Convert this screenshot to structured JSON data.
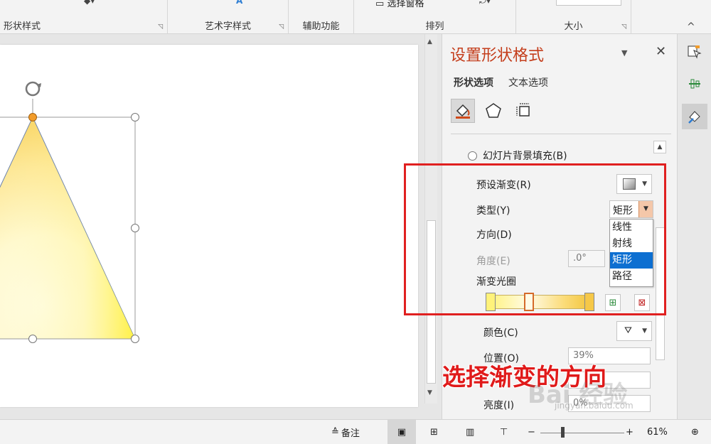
{
  "ribbon": {
    "groups": [
      {
        "label": "形状样式",
        "launcher": "◹"
      },
      {
        "label": "艺术字样式",
        "launcher": "◹"
      },
      {
        "label": "辅助功能"
      },
      {
        "label": "排列"
      },
      {
        "label": "大小",
        "launcher": "◹"
      }
    ],
    "selection_pane_label": "选择窗格",
    "collapse_icon": "^"
  },
  "pane": {
    "title": "设置形状格式",
    "dropdown_icon": "▼",
    "close_icon": "✕",
    "tabs": [
      {
        "label": "形状选项",
        "active": true
      },
      {
        "label": "文本选项",
        "active": false
      }
    ],
    "categories": [
      "fill-line-icon",
      "effects-icon",
      "size-properties-icon"
    ],
    "slide_bg_fill_label": "幻灯片背景填充(B)",
    "preset_gradient_label": "预设渐变(R)",
    "type_label": "类型(Y)",
    "type_value": "矩形",
    "type_options": [
      {
        "label": "线性",
        "selected": false
      },
      {
        "label": "射线",
        "selected": false
      },
      {
        "label": "矩形",
        "selected": true
      },
      {
        "label": "路径",
        "selected": false
      }
    ],
    "direction_label": "方向(D)",
    "angle_label": "角度(E)",
    "angle_value": ".0°",
    "gradient_stops_label": "渐变光圈",
    "color_label": "颜色(C)",
    "position_label": "位置(O)",
    "position_value": "39%",
    "brightness_label": "亮度(I)",
    "brightness_value": "0%",
    "accent_color": "#c43e1c"
  },
  "annotation": {
    "text": "选择渐变的方向",
    "color": "#e01a1a"
  },
  "watermark": {
    "text": "Bai 经验",
    "url": "jingyan.baidu.com"
  },
  "statusbar": {
    "notes_label": "备注",
    "zoom_minus": "−",
    "zoom_plus": "+",
    "zoom_percent": 61,
    "zoom_label": "61%"
  },
  "shape": {
    "gradient_colors": [
      "#f7c843",
      "#fffbe8",
      "#fff35a"
    ]
  }
}
